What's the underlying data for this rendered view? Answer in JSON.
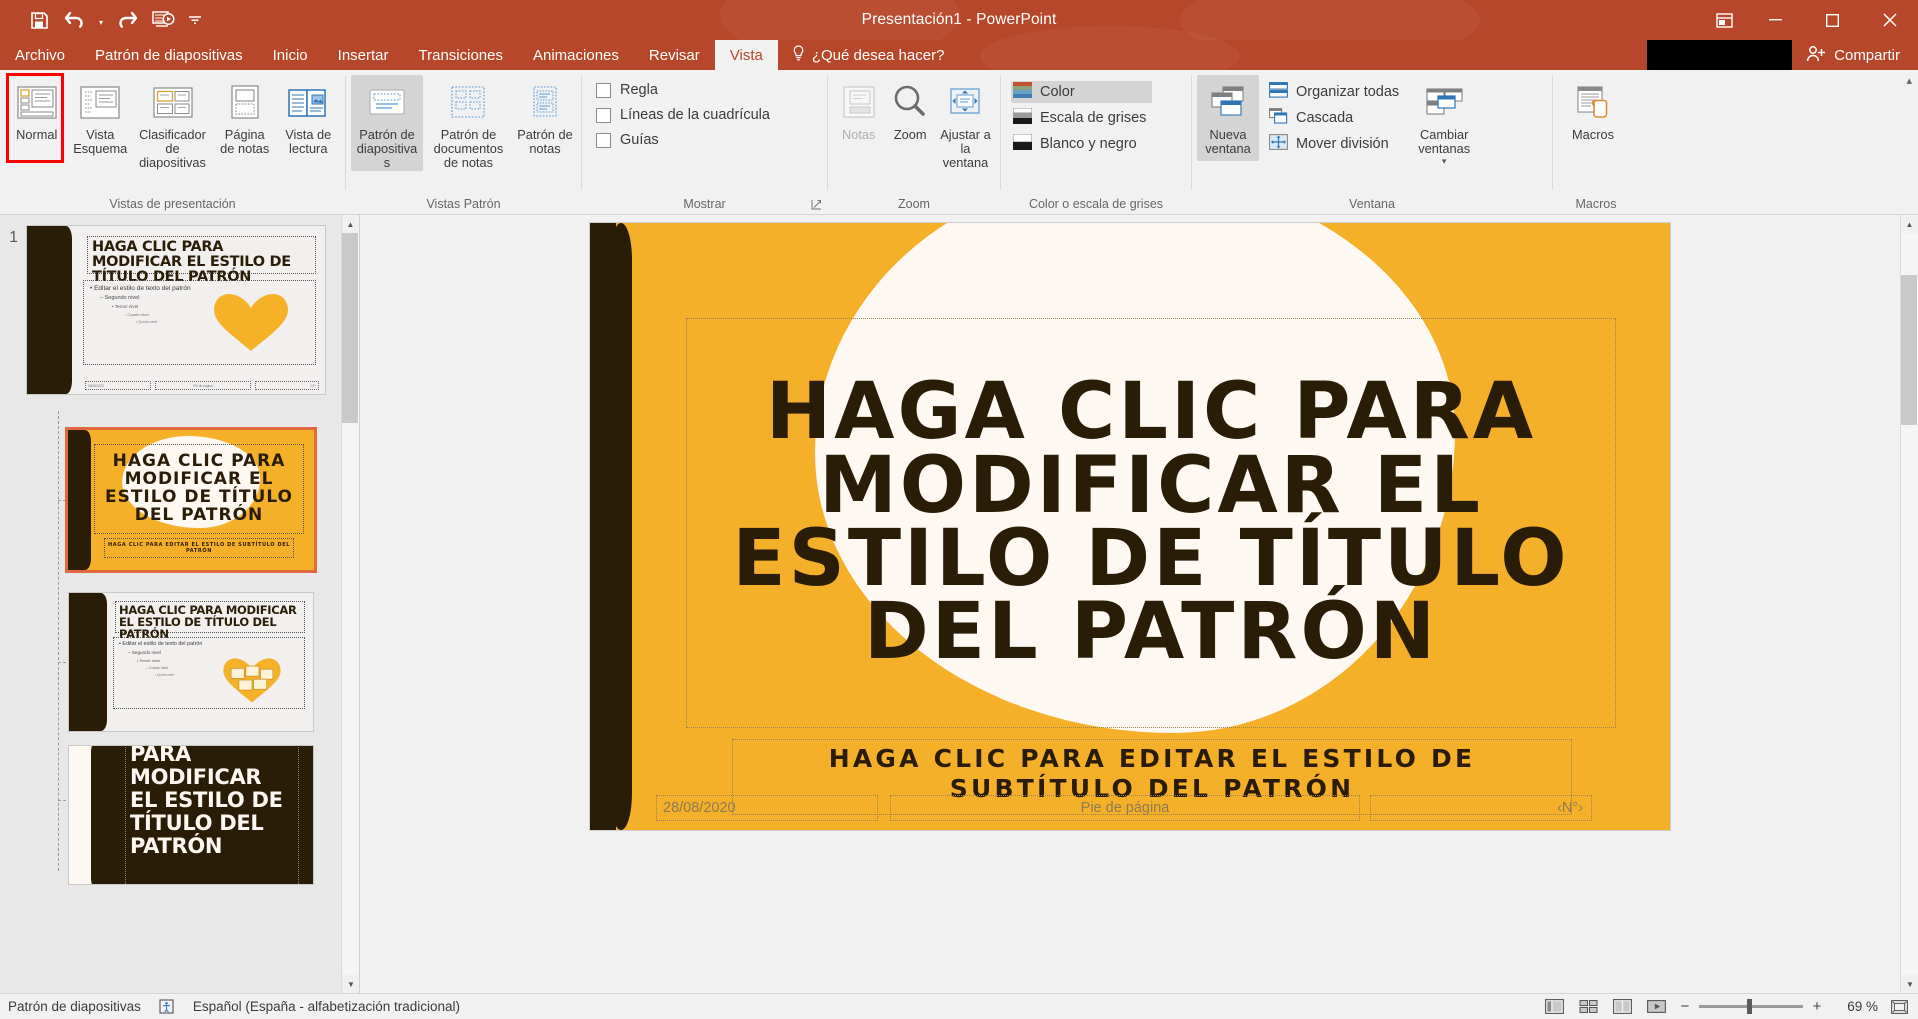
{
  "window": {
    "title": "Presentación1 - PowerPoint",
    "quick_access": [
      "save-icon",
      "undo-icon",
      "redo-icon",
      "start-presentation-icon",
      "customize-qat-icon"
    ],
    "controls": [
      "ribbon-display-options-icon",
      "minimize-icon",
      "restore-icon",
      "close-icon"
    ],
    "accent_color": "#b7472a"
  },
  "tabs": [
    {
      "label": "Archivo",
      "active": false
    },
    {
      "label": "Patrón de diapositivas",
      "active": false
    },
    {
      "label": "Inicio",
      "active": false
    },
    {
      "label": "Insertar",
      "active": false
    },
    {
      "label": "Transiciones",
      "active": false
    },
    {
      "label": "Animaciones",
      "active": false
    },
    {
      "label": "Revisar",
      "active": false
    },
    {
      "label": "Vista",
      "active": true
    }
  ],
  "tell_me": "¿Qué desea hacer?",
  "share_label": "Compartir",
  "ribbon": {
    "groups": [
      {
        "label": "Vistas de presentación",
        "buttons": [
          {
            "label": "Normal",
            "state": "highlighted"
          },
          {
            "label": "Vista Esquema",
            "state": "normal"
          },
          {
            "label": "Clasificador de diapositivas",
            "state": "normal"
          },
          {
            "label": "Página de notas",
            "state": "normal"
          },
          {
            "label": "Vista de lectura",
            "state": "normal"
          }
        ]
      },
      {
        "label": "Vistas Patrón",
        "buttons": [
          {
            "label": "Patrón de diapositivas",
            "state": "active"
          },
          {
            "label": "Patrón de documentos de notas",
            "state": "normal"
          },
          {
            "label": "Patrón de notas",
            "state": "normal"
          }
        ]
      },
      {
        "label": "Mostrar",
        "checkboxes": [
          {
            "label": "Regla",
            "checked": false
          },
          {
            "label": "Líneas de la cuadrícula",
            "checked": false
          },
          {
            "label": "Guías",
            "checked": false
          }
        ]
      },
      {
        "label": "Zoom",
        "buttons": [
          {
            "label": "Notas",
            "state": "disabled"
          },
          {
            "label": "Zoom",
            "state": "normal"
          },
          {
            "label": "Ajustar a la ventana",
            "state": "normal"
          }
        ]
      },
      {
        "label": "Color o escala de grises",
        "options": [
          {
            "label": "Color",
            "selected": true
          },
          {
            "label": "Escala de grises",
            "selected": false
          },
          {
            "label": "Blanco y negro",
            "selected": false
          }
        ]
      },
      {
        "label": "Ventana",
        "buttons": [
          {
            "label": "Nueva ventana",
            "state": "active"
          },
          {
            "label": "Cambiar ventanas",
            "state": "normal"
          }
        ],
        "commands": [
          {
            "label": "Organizar todas"
          },
          {
            "label": "Cascada"
          },
          {
            "label": "Mover división"
          }
        ]
      },
      {
        "label": "Macros",
        "buttons": [
          {
            "label": "Macros",
            "state": "normal"
          }
        ]
      }
    ]
  },
  "thumbnails": {
    "master_number": "1",
    "items": [
      {
        "kind": "master",
        "selected": false,
        "title": "HAGA CLIC PARA MODIFICAR EL ESTILO DE TÍTULO DEL PATRÓN",
        "body_levels": [
          "Editar el estilo de texto del patrón",
          "Segundo nivel",
          "Tercer nivel",
          "Cuarto nivel",
          "Quinto nivel"
        ],
        "footer_date": "28/08/2020",
        "footer_center": "Pie de página",
        "footer_number": "‹N°›"
      },
      {
        "kind": "layout-title",
        "selected": true,
        "title": "HAGA CLIC PARA MODIFICAR EL ESTILO DE TÍTULO DEL PATRÓN",
        "subtitle": "HAGA CLIC PARA EDITAR EL ESTILO DE SUBTÍTULO DEL PATRÓN"
      },
      {
        "kind": "layout-content",
        "selected": false,
        "title": "HAGA CLIC PARA MODIFICAR EL ESTILO DE TÍTULO DEL PATRÓN",
        "body_levels": [
          "Editar el estilo de texto del patrón",
          "Segundo nivel",
          "Tercer nivel",
          "Cuarto nivel",
          "Quinto nivel"
        ]
      },
      {
        "kind": "layout-section",
        "selected": false,
        "title": "PARA MODIFICAR EL ESTILO DE TÍTULO DEL PATRÓN"
      }
    ]
  },
  "slide": {
    "title": "HAGA CLIC PARA MODIFICAR EL ESTILO DE TÍTULO DEL PATRÓN",
    "subtitle": "HAGA CLIC PARA EDITAR EL ESTILO DE SUBTÍTULO DEL PATRÓN",
    "footer_date": "28/08/2020",
    "footer_center": "Pie de página",
    "footer_number": "‹N°›",
    "background_color": "#f5b02a",
    "accent_dark": "#2a1d08",
    "blob_color": "#fdf9f2"
  },
  "statusbar": {
    "view_name": "Patrón de diapositivas",
    "language": "Español (España - alfabetización tradicional)",
    "accessibility_icon": "accessibility-checker-icon",
    "view_buttons": [
      "normal-view-icon",
      "slide-sorter-icon",
      "reading-view-icon",
      "slideshow-icon"
    ],
    "zoom_out": "−",
    "zoom_in": "+",
    "zoom_value": "69 %",
    "fit_icon": "fit-slide-icon"
  }
}
